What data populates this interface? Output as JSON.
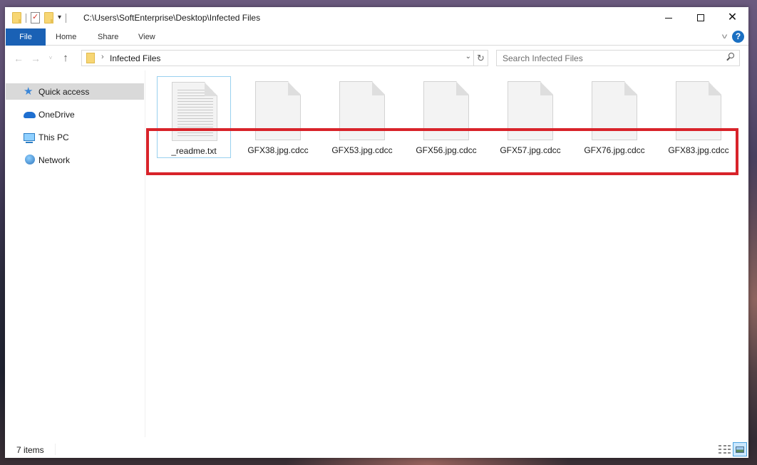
{
  "window": {
    "title": "C:\\Users\\SoftEnterprise\\Desktop\\Infected Files",
    "controls": {
      "minimize": "minimize",
      "maximize": "maximize",
      "close": "✕"
    }
  },
  "ribbon": {
    "tabs": [
      {
        "label": "File"
      },
      {
        "label": "Home"
      },
      {
        "label": "Share"
      },
      {
        "label": "View"
      }
    ],
    "help": "?"
  },
  "navigation": {
    "back": "←",
    "forward": "→",
    "recent": "˅",
    "up": "↑",
    "breadcrumb_separator": "›",
    "current_folder": "Infected Files",
    "dropdown": "⌄",
    "refresh": "↻",
    "search_placeholder": "Search Infected Files"
  },
  "sidebar": {
    "items": [
      {
        "label": "Quick access",
        "icon": "star-icon",
        "selected": true
      },
      {
        "label": "OneDrive",
        "icon": "cloud-icon",
        "selected": false
      },
      {
        "label": "This PC",
        "icon": "monitor-icon",
        "selected": false
      },
      {
        "label": "Network",
        "icon": "network-icon",
        "selected": false
      }
    ]
  },
  "files": [
    {
      "name": "_readme.txt",
      "type": "text-document"
    },
    {
      "name": "GFX38.jpg.cdcc",
      "type": "blank-document"
    },
    {
      "name": "GFX53.jpg.cdcc",
      "type": "blank-document"
    },
    {
      "name": "GFX56.jpg.cdcc",
      "type": "blank-document"
    },
    {
      "name": "GFX57.jpg.cdcc",
      "type": "blank-document"
    },
    {
      "name": "GFX76.jpg.cdcc",
      "type": "blank-document"
    },
    {
      "name": "GFX83.jpg.cdcc",
      "type": "blank-document"
    }
  ],
  "status": {
    "item_count": "7 items",
    "active_view": "large-icons"
  },
  "colors": {
    "accent": "#1a61b5",
    "highlight_box": "#d8232a",
    "selection": "#d9d9d9",
    "focus_border": "#99d1ef"
  }
}
